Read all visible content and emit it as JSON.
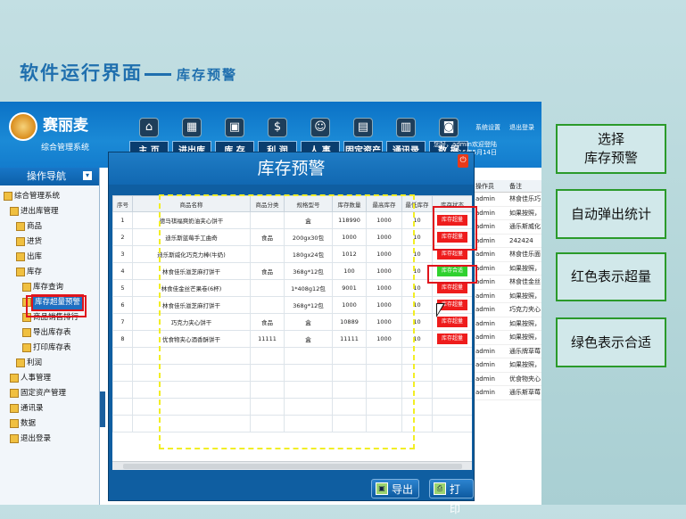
{
  "slide": {
    "title": "软件运行界面",
    "subtitle": "库存预警"
  },
  "app": {
    "brand": "赛丽麦",
    "brand_sub": "综合管理系统",
    "nav": [
      {
        "label": "主 页",
        "icon": "home-icon",
        "glyph": "⌂"
      },
      {
        "label": "进出库",
        "icon": "box-icon",
        "glyph": "▦"
      },
      {
        "label": "库 存",
        "icon": "warehouse-icon",
        "glyph": "▣"
      },
      {
        "label": "利 润",
        "icon": "coin-icon",
        "glyph": "$"
      },
      {
        "label": "人 事",
        "icon": "person-icon",
        "glyph": "☺"
      },
      {
        "label": "固定资产",
        "icon": "computer-icon",
        "glyph": "▤"
      },
      {
        "label": "通讯录",
        "icon": "book-icon",
        "glyph": "▥"
      },
      {
        "label": "数 据",
        "icon": "database-icon",
        "glyph": "◙"
      }
    ],
    "sys_settings": "系统设置",
    "logout": "退出登录",
    "welcome": "您好，admin欢迎登陆",
    "date": "2016年5月14日",
    "sidebar_title": "操作导航",
    "tree": [
      {
        "label": "综合管理系统",
        "indent": 0
      },
      {
        "label": "进出库管理",
        "indent": 1
      },
      {
        "label": "商品",
        "indent": 2
      },
      {
        "label": "进货",
        "indent": 2
      },
      {
        "label": "出库",
        "indent": 2
      },
      {
        "label": "库存",
        "indent": 2
      },
      {
        "label": "库存查询",
        "indent": 3
      },
      {
        "label": "库存超量预警",
        "indent": 3
      },
      {
        "label": "商品销售排行",
        "indent": 3
      },
      {
        "label": "导出库存表",
        "indent": 3
      },
      {
        "label": "打印库存表",
        "indent": 3
      },
      {
        "label": "利润",
        "indent": 2
      },
      {
        "label": "人事管理",
        "indent": 1
      },
      {
        "label": "固定资产管理",
        "indent": 1
      },
      {
        "label": "通讯录",
        "indent": 1
      },
      {
        "label": "数据",
        "indent": 1
      },
      {
        "label": "退出登录",
        "indent": 1
      }
    ],
    "right_table": {
      "headers": [
        "操作员",
        "备注"
      ],
      "rows": [
        [
          "admin",
          "林食佳乐巧克..."
        ],
        [
          "admin",
          "如果按照，遇..."
        ],
        [
          "admin",
          "通乐斯威化泳..."
        ],
        [
          "admin",
          "242424"
        ],
        [
          "admin",
          "林食佳乐面饼..."
        ],
        [
          "admin",
          "如果按照，遇..."
        ],
        [
          "admin",
          "林食佳金丝芒..."
        ],
        [
          "admin",
          "如果按照，遇..."
        ],
        [
          "admin",
          "巧克力夹心饼..."
        ],
        [
          "admin",
          "如果按照，遇..."
        ],
        [
          "admin",
          "如果按照，遇..."
        ],
        [
          "admin",
          "通乐牌草莓饮..."
        ],
        [
          "admin",
          "如果按照，遇..."
        ],
        [
          "admin",
          "优食物夹心巧..."
        ],
        [
          "admin",
          "通乐斯草莓..."
        ]
      ]
    }
  },
  "modal": {
    "title": "库存预警",
    "headers": [
      "序号",
      "商品名称",
      "商品分类",
      "规格型号",
      "库存数量",
      "最高库存",
      "最低库存",
      "库存状态"
    ],
    "rows": [
      [
        "1",
        "德马祺福爽奶油夹心饼干",
        "",
        "盒",
        "118990",
        "1000",
        "10",
        "库存超量",
        "red"
      ],
      [
        "2",
        "迪乐斯蓝莓手工曲奇",
        "食品",
        "200gx30包",
        "1000",
        "1000",
        "10",
        "库存超量",
        "red"
      ],
      [
        "3",
        "迪乐斯威化巧克力棒(牛奶)",
        "",
        "180gx24包",
        "1012",
        "1000",
        "10",
        "库存超量",
        "red"
      ],
      [
        "4",
        "林食佳乐滋芝麻打饼干",
        "食品",
        "368g*12包",
        "100",
        "1000",
        "10",
        "库存合适",
        "green"
      ],
      [
        "5",
        "林食佳金丝芒果卷(6杯)",
        "",
        "1*408g12包",
        "9001",
        "1000",
        "10",
        "库存超量",
        "red"
      ],
      [
        "6",
        "林食佳乐滋芝麻打饼干",
        "",
        "368g*12包",
        "1000",
        "1000",
        "10",
        "库存超量",
        "red"
      ],
      [
        "7",
        "巧克力夹心饼干",
        "食品",
        "盒",
        "10889",
        "1000",
        "10",
        "库存超量",
        "red"
      ],
      [
        "8",
        "优食物夹心酒香酥饼干",
        "11111",
        "盒",
        "11111",
        "1000",
        "10",
        "库存超量",
        "red"
      ]
    ],
    "export_label": "导出",
    "print_label": "打印"
  },
  "callouts": [
    "选择\n库存预警",
    "自动弹出统计",
    "红色表示超量",
    "绿色表示合适"
  ],
  "colors": {
    "accent": "#1f6fae",
    "over": "#ee1c1c",
    "ok": "#2fd12f",
    "callout_border": "#2a9a2a"
  }
}
